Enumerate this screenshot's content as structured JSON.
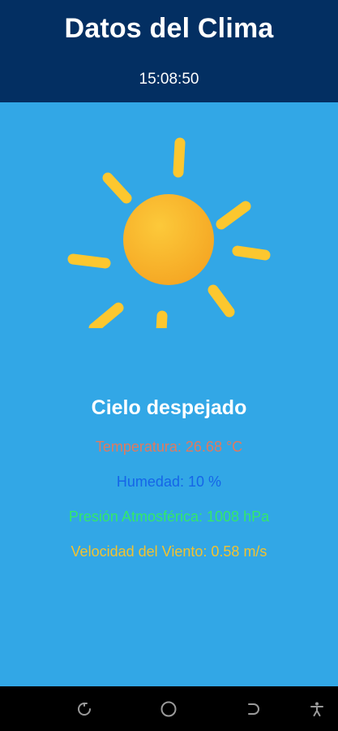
{
  "header": {
    "title": "Datos del Clima",
    "time": "15:08:50"
  },
  "weather": {
    "icon": "sun-icon",
    "condition": "Cielo despejado",
    "temperature": {
      "label": "Temperatura:",
      "value": "26.68",
      "unit": "°C",
      "color": "#e07a5f"
    },
    "humidity": {
      "label": "Humedad:",
      "value": "10",
      "unit": "%",
      "color": "#1565e8"
    },
    "pressure": {
      "label": "Presión Atmosférica:",
      "value": "1008",
      "unit": "hPa",
      "color": "#33e86a"
    },
    "wind": {
      "label": "Velocidad del Viento:",
      "value": "0.58",
      "unit": "m/s",
      "color": "#f2c230"
    }
  },
  "colors": {
    "header_bg": "#032f62",
    "main_bg": "#32a7e6",
    "sun": "#fbbf24"
  },
  "navbar": {
    "icons": [
      "recent-apps-icon",
      "home-icon",
      "back-icon",
      "accessibility-icon"
    ]
  }
}
